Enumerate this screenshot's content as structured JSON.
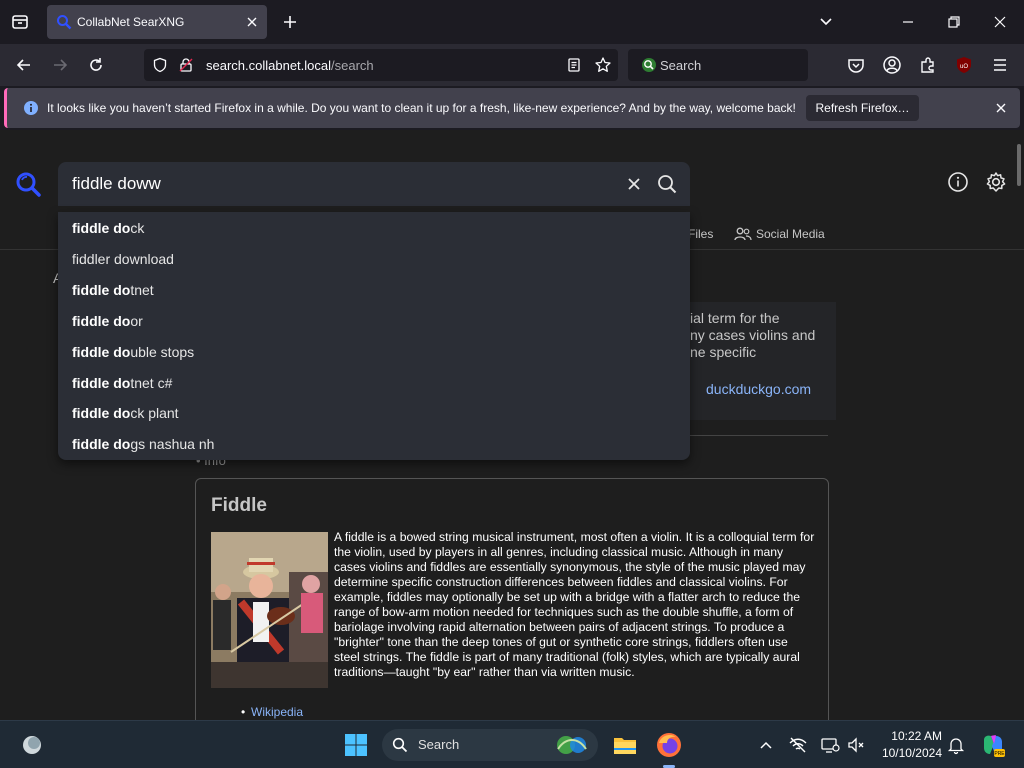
{
  "browser": {
    "tab": {
      "title": "CollabNet SearXNG",
      "favicon": "searxng-icon"
    },
    "url": {
      "host": "search.collabnet.local",
      "path": "/search"
    },
    "websearch": {
      "placeholder": "Search"
    }
  },
  "notification": {
    "text": "It looks like you haven’t started Firefox in a while. Do you want to clean it up for a fresh, like-new experience? And by the way, welcome back!",
    "button": "Refresh Firefox…"
  },
  "search": {
    "query": "fiddle doww",
    "suggestions": [
      {
        "bold": "fiddle do",
        "rest": "ck"
      },
      {
        "bold": "",
        "rest": "fiddler download"
      },
      {
        "bold": "fiddle do",
        "rest": "tnet"
      },
      {
        "bold": "fiddle do",
        "rest": "or"
      },
      {
        "bold": "fiddle do",
        "rest": "uble stops"
      },
      {
        "bold": "fiddle do",
        "rest": "tnet c#"
      },
      {
        "bold": "fiddle do",
        "rest": "ck plant"
      },
      {
        "bold": "fiddle do",
        "rest": "gs nashua nh"
      }
    ]
  },
  "categories": {
    "files": "Files",
    "social": "Social Media"
  },
  "answer": {
    "left_letter": "A",
    "snippet_lines": [
      "ial term for the",
      "ny cases violins and",
      "ne specific"
    ],
    "source": "duckduckgo.com"
  },
  "infobox": {
    "section_label": "• Info",
    "title": "Fiddle",
    "content": "A fiddle is a bowed string musical instrument, most often a violin. It is a colloquial term for the violin, used by players in all genres, including classical music. Although in many cases violins and fiddles are essentially synonymous, the style of the music played may determine specific construction differences between fiddles and classical violins. For example, fiddles may optionally be set up with a bridge with a flatter arch to reduce the range of bow-arm motion needed for techniques such as the double shuffle, a form of bariolage involving rapid alternation between pairs of adjacent strings. To produce a \"brighter\" tone than the deep tones of gut or synthetic core strings, fiddlers often use steel strings. The fiddle is part of many traditional (folk) styles, which are typically aural traditions—taught \"by ear\" rather than via written music.",
    "link": "Wikipedia"
  },
  "taskbar": {
    "search_label": "Search",
    "time": "10:22 AM",
    "date": "10/10/2024"
  },
  "colors": {
    "accent": "#8ab4f8",
    "notif_stripe": "#ff6bba",
    "searxng_blue": "#3050ff"
  }
}
